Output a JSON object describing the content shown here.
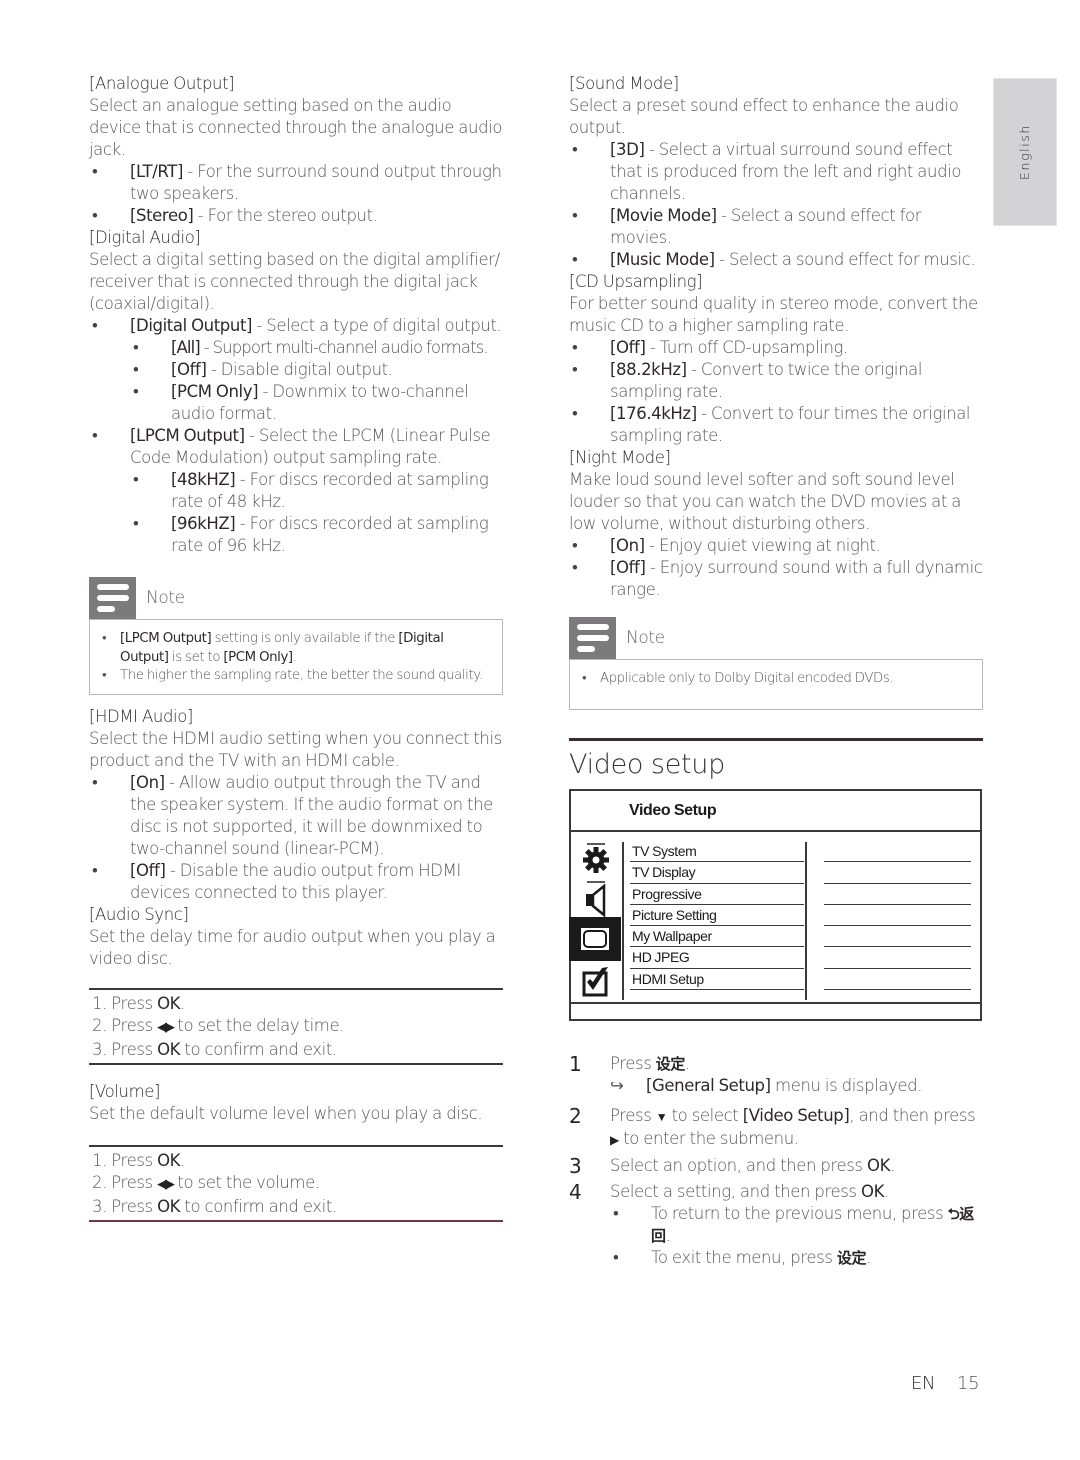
{
  "sidebar_tab": {
    "label": "English"
  },
  "left": {
    "analogue": {
      "title": "[Analogue Output]",
      "desc": "Select an analogue setting based on the audio device that is connected through the analogue audio jack.",
      "options": [
        {
          "key": "[LT/RT]",
          "text": " - For the surround sound output through two speakers."
        },
        {
          "key": "[Stereo]",
          "text": " - For the stereo output."
        }
      ]
    },
    "digital": {
      "title": "[Digital Audio]",
      "desc": "Select a digital setting based on the digital amplifier/ receiver that is connected through the digital jack (coaxial/digital).",
      "digital_output": {
        "key": "[Digital Output]",
        "text": " - Select a type of digital output.",
        "options": [
          {
            "key": "[All]",
            "text": " - Support multi-channel audio formats."
          },
          {
            "key": "[Off]",
            "text": " - Disable digital output."
          },
          {
            "key": "[PCM Only]",
            "text": " - Downmix to two-channel audio format."
          }
        ]
      },
      "lpcm_output": {
        "key": "[LPCM Output]",
        "text": " - Select the LPCM (Linear Pulse Code Modulation) output sampling rate.",
        "options": [
          {
            "key": "[48kHZ]",
            "text": " - For discs recorded at sampling rate of 48 kHz."
          },
          {
            "key": "[96kHZ]",
            "text": " - For discs recorded at sampling rate of 96 kHz."
          }
        ]
      }
    },
    "note": {
      "title": "Note",
      "item1": {
        "k1": "[LPCM Output]",
        "t1": " setting is only available if the ",
        "k2": "[Digital Output]",
        "t2": " is set to ",
        "k3": "[PCM Only]",
        "t3": "."
      },
      "item2": "The higher the sampling rate, the better the sound quality."
    },
    "hdmi": {
      "title": "[HDMI Audio]",
      "desc": "Select the HDMI audio setting when you connect this product and the TV with an HDMI cable.",
      "options": [
        {
          "key": "[On]",
          "text": " - Allow audio output through the TV and the speaker system. If the audio format on the disc is not supported, it will be downmixed to two-channel sound (linear-PCM)."
        },
        {
          "key": "[Off]",
          "text": " - Disable the audio output from HDMI devices connected to this player."
        }
      ]
    },
    "sync": {
      "title": "[Audio Sync]",
      "desc": "Set the delay time for audio output when you play a video disc.",
      "steps": [
        {
          "pre": "1. Press ",
          "key": "OK",
          "post": "."
        },
        {
          "pre": "2. Press ",
          "arrows": "◀▶",
          "post": " to set the delay time."
        },
        {
          "pre": "3. Press ",
          "key": "OK",
          "post": " to confirm and exit."
        }
      ]
    },
    "volume": {
      "title": "[Volume]",
      "desc": "Set the default volume level when you play a disc.",
      "steps": [
        {
          "pre": "1. Press ",
          "key": "OK",
          "post": "."
        },
        {
          "pre": "2. Press ",
          "arrows": "◀▶",
          "post": " to set the volume."
        },
        {
          "pre": "3. Press ",
          "key": "OK",
          "post": " to confirm and exit."
        }
      ]
    }
  },
  "right": {
    "sound_mode": {
      "title": "[Sound Mode]",
      "desc": "Select a preset sound effect to enhance the audio output.",
      "options": [
        {
          "key": "[3D]",
          "text": " - Select a virtual surround sound effect that is produced from the left and right audio channels."
        },
        {
          "key": "[Movie Mode]",
          "text": " - Select a sound effect for movies."
        },
        {
          "key": "[Music Mode]",
          "text": " - Select a sound effect for music."
        }
      ]
    },
    "cd_upsampling": {
      "title": "[CD Upsampling]",
      "desc": "For better sound quality in stereo mode, convert the music CD to a higher sampling rate.",
      "options": [
        {
          "key": "[Off]",
          "text": " - Turn off CD-upsampling."
        },
        {
          "key": "[88.2kHz]",
          "text": " - Convert to twice the original sampling rate."
        },
        {
          "key": "[176.4kHz]",
          "text": " - Convert to four times the original sampling rate."
        }
      ]
    },
    "night_mode": {
      "title": "[Night Mode]",
      "desc": "Make loud sound level softer and soft sound level louder so that you can watch the DVD movies at a low volume, without disturbing others.",
      "options": [
        {
          "key": "[On]",
          "text": " - Enjoy quiet viewing at night."
        },
        {
          "key": "[Off]",
          "text": " - Enjoy surround sound with a full dynamic range."
        }
      ]
    },
    "note": {
      "title": "Note",
      "item1": "Applicable only to Dolby Digital encoded DVDs."
    },
    "video_setup": {
      "heading": "Video setup",
      "menu": {
        "title": "Video Setup",
        "icons": [
          "gear-icon",
          "speaker-icon",
          "screen-icon",
          "checkbox-icon"
        ],
        "selected_icon": "screen-icon",
        "items": [
          "TV System",
          "TV Display",
          "Progressive",
          "Picture Setting",
          "My Wallpaper",
          "HD JPEG",
          "HDMI Setup"
        ]
      },
      "steps": [
        {
          "num": "1",
          "pre": "Press ",
          "cjk": "设定",
          "post": ".",
          "result_arrow": "↪",
          "result_key": "[General Setup]",
          "result_text": " menu is displayed."
        },
        {
          "num": "2",
          "pre": "Press ",
          "down": "▼",
          "mid1": " to select ",
          "key": "[Video Setup]",
          "mid2": ", and then press ",
          "right": "▶",
          "post": " to enter the submenu."
        },
        {
          "num": "3",
          "pre": "Select an option, and then press ",
          "key": "OK",
          "post": "."
        },
        {
          "num": "4",
          "pre": "Select a setting, and then press ",
          "key": "OK",
          "post": ".",
          "bullets": [
            {
              "pre": "To return to the previous menu, press ",
              "cjk": "⮌返回",
              "post": "."
            },
            {
              "pre": "To exit the menu, press ",
              "cjk": "设定",
              "post": "."
            }
          ]
        }
      ]
    }
  },
  "footer": {
    "lang": "EN",
    "page": "15"
  }
}
